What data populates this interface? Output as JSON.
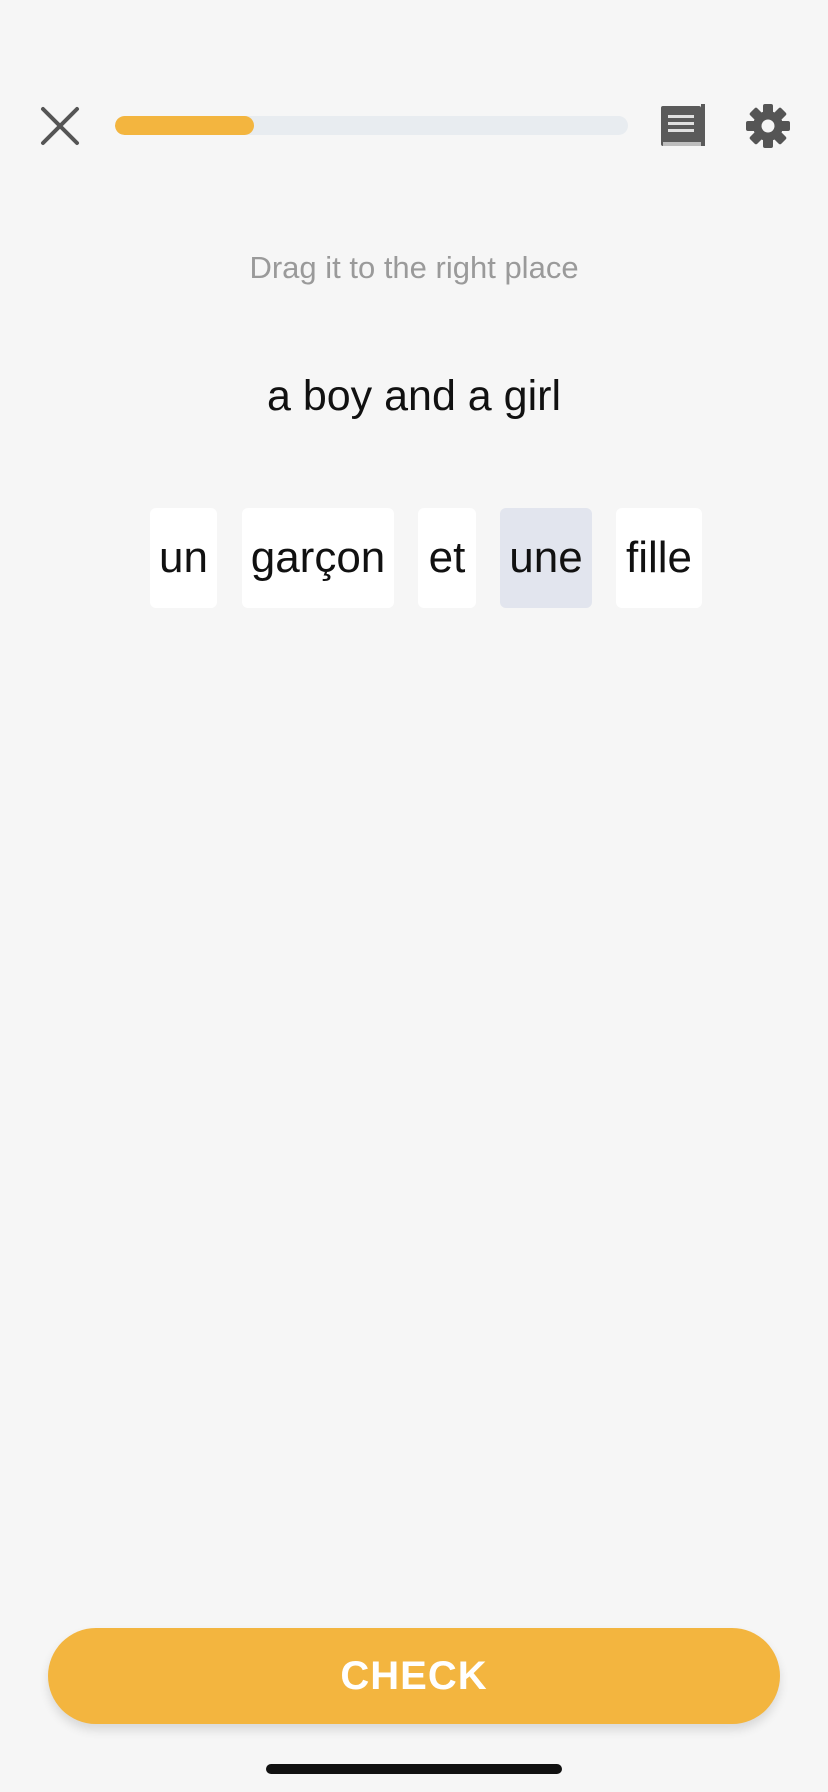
{
  "header": {
    "close_icon": "close-icon",
    "notes_icon": "notes-icon",
    "settings_icon": "gear-icon",
    "progress": 0.27
  },
  "exercise": {
    "instruction": "Drag it to the right place",
    "prompt": "a boy and a girl",
    "tiles": [
      {
        "label": "un",
        "selected": false
      },
      {
        "label": "garçon",
        "selected": false
      },
      {
        "label": "et",
        "selected": false
      },
      {
        "label": "une",
        "selected": true
      },
      {
        "label": "fille",
        "selected": false
      }
    ]
  },
  "footer": {
    "check_label": "CHECK"
  },
  "colors": {
    "accent": "#f3b53f",
    "background": "#f6f6f6",
    "tile_selected": "#e2e5ee",
    "progress_track": "#e8ecf0"
  }
}
